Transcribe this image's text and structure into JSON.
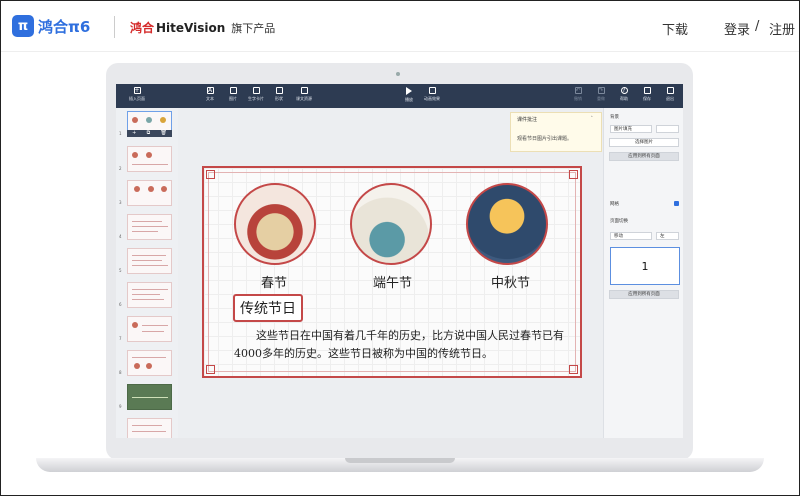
{
  "site": {
    "logo_mark": "π",
    "logo_text": "鸿合π6",
    "brand_cn": "鸿合",
    "brand_en": "HiteVision",
    "brand_sub": "旗下产品",
    "nav": {
      "download": "下载",
      "login": "登录",
      "separator": "/",
      "register": "注册"
    }
  },
  "toolbar": {
    "insert_page": "插入页面",
    "text": "文本",
    "image": "图片",
    "flashcard": "生字卡片",
    "shape": "形状",
    "resource": "课文资源",
    "play": "播放",
    "animation": "动画效果",
    "undo": "撤销",
    "redo": "重做",
    "help": "帮助",
    "save": "保存",
    "exit": "退出"
  },
  "thumbnails": {
    "numbers": [
      "1",
      "2",
      "3",
      "4",
      "5",
      "6",
      "7",
      "8",
      "9",
      "10"
    ],
    "controls": [
      "+",
      "⧉",
      "🗑"
    ]
  },
  "popover": {
    "title": "课件批注",
    "body": "观看节日图片引出课题。"
  },
  "slide": {
    "festivals": [
      "春节",
      "端午节",
      "中秋节"
    ],
    "title": "传统节日",
    "body": "这些节日在中国有着几千年的历史，比方说中国人民过春节已有4000多年的历史。这些节日被称为中国的传统节日。"
  },
  "panel": {
    "background_label": "背景",
    "fill_select": "图片填充",
    "choose_image": "选择图片",
    "apply_all_1": "应用到所有页面",
    "grid_label": "网格",
    "transition_label": "页面切换",
    "transition_select": "移动",
    "direction_select": "左",
    "preview_number": "1",
    "apply_all_2": "应用到所有页面"
  }
}
